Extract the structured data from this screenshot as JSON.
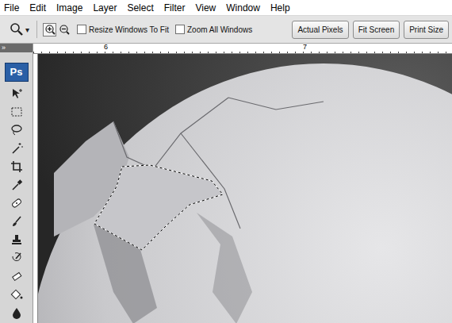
{
  "menu": [
    "File",
    "Edit",
    "Image",
    "Layer",
    "Select",
    "Filter",
    "View",
    "Window",
    "Help"
  ],
  "options": {
    "tool_dropdown": "▾",
    "zoom_modes": [
      {
        "kind": "in",
        "selected": true
      },
      {
        "kind": "out",
        "selected": false
      }
    ],
    "checkboxes": [
      {
        "label": "Resize Windows To Fit",
        "checked": false
      },
      {
        "label": "Zoom All Windows",
        "checked": false
      }
    ],
    "buttons": [
      "Actual Pixels",
      "Fit Screen",
      "Print Size"
    ]
  },
  "toolbar": {
    "collapse": "»",
    "logo": "Ps"
  },
  "ruler": {
    "labels": [
      "6",
      "7"
    ]
  }
}
